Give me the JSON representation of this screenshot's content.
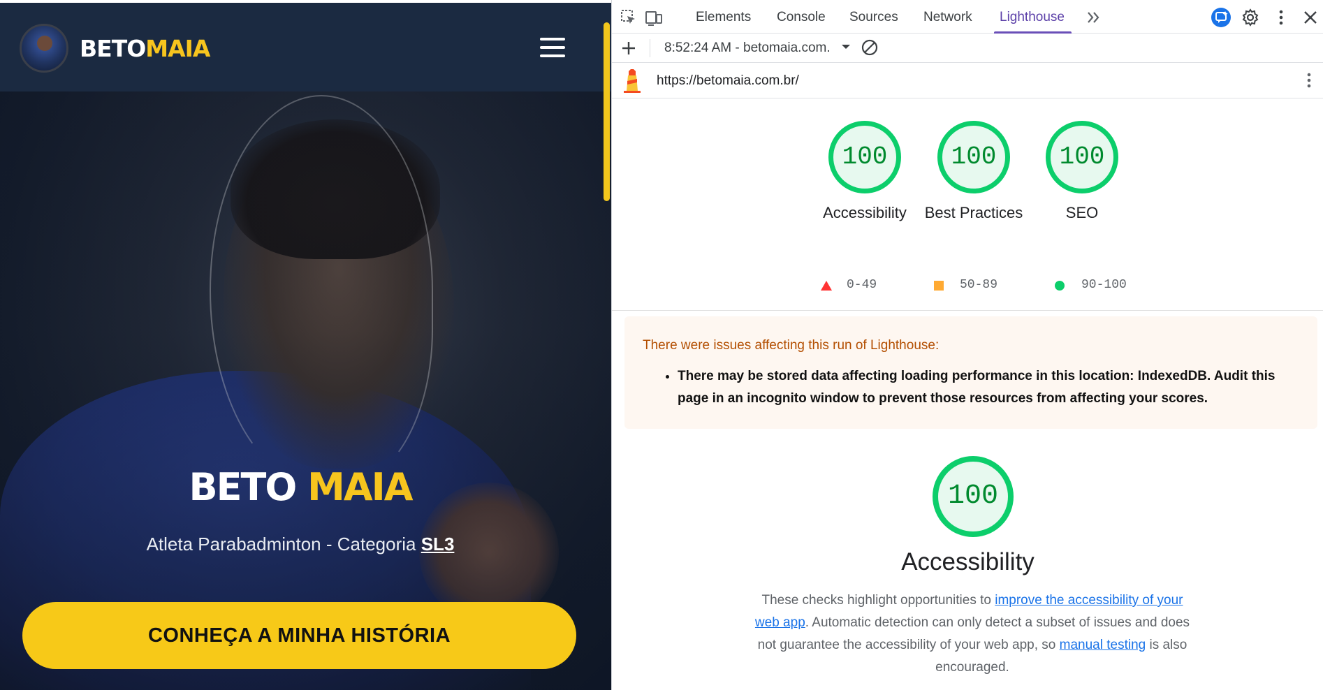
{
  "site": {
    "logo": {
      "part1": "BETO",
      "part2": "MAIA"
    },
    "hero": {
      "title_part1": "BETO",
      "title_part2": "MAIA",
      "subtitle": "Atleta Parabadminton - Categoria ",
      "subtitle_tag": "SL3",
      "cta_label": "CONHEÇA A MINHA HISTÓRIA"
    },
    "colors": {
      "header_bg": "#1b2a41",
      "accent": "#f7c918"
    }
  },
  "devtools": {
    "tabs": [
      {
        "label": "Elements"
      },
      {
        "label": "Console"
      },
      {
        "label": "Sources"
      },
      {
        "label": "Network"
      },
      {
        "label": "Lighthouse",
        "active": true
      }
    ],
    "report_time": "8:52:24 AM - betomaia.com.",
    "url": "https://betomaia.com.br/",
    "scores": [
      {
        "label": "Accessibility",
        "value": "100"
      },
      {
        "label": "Best Practices",
        "value": "100"
      },
      {
        "label": "SEO",
        "value": "100"
      }
    ],
    "legend": [
      {
        "range": "0-49",
        "color": "#ff3333"
      },
      {
        "range": "50-89",
        "color": "#ffaa33"
      },
      {
        "range": "90-100",
        "color": "#0cce6b"
      }
    ],
    "warning": {
      "title": "There were issues affecting this run of Lighthouse:",
      "item": "There may be stored data affecting loading performance in this location: IndexedDB. Audit this page in an incognito window to prevent those resources from affecting your scores."
    },
    "category": {
      "score": "100",
      "title": "Accessibility",
      "desc_part1": "These checks highlight opportunities to ",
      "link1": "improve the accessibility of your web app",
      "desc_part2": ". Automatic detection can only detect a subset of issues and does not guarantee the accessibility of your web app, so ",
      "link2": "manual testing",
      "desc_part3": " is also encouraged."
    }
  }
}
